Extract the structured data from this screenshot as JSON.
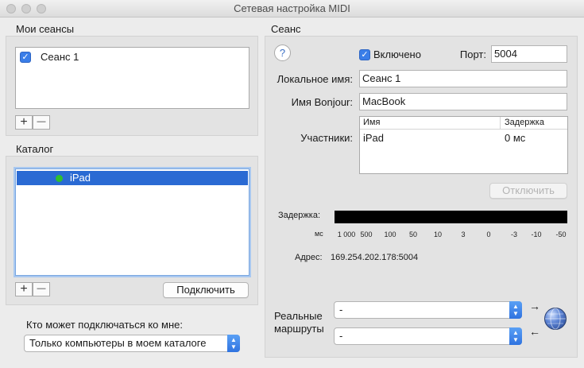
{
  "window": {
    "title": "Сетевая настройка MIDI"
  },
  "my_sessions": {
    "title": "Мои сеансы",
    "items": [
      {
        "label": "Сеанс 1",
        "checked": true
      }
    ],
    "add_label": "+",
    "remove_label": "—"
  },
  "directory": {
    "title": "Каталог",
    "items": [
      {
        "label": "iPad",
        "status_color": "#2ec02e",
        "selected": true
      }
    ],
    "add_label": "+",
    "remove_label": "—",
    "connect_label": "Подключить"
  },
  "who_can_connect": {
    "label": "Кто может подключаться ко мне:",
    "value": "Только компьютеры в моем каталоге"
  },
  "session": {
    "title": "Сеанс",
    "help_label": "?",
    "enabled_label": "Включено",
    "enabled": true,
    "port_label": "Порт:",
    "port_value": "5004",
    "local_name_label": "Локальное имя:",
    "local_name_value": "Сеанс 1",
    "bonjour_label": "Имя Bonjour:",
    "bonjour_value": "MacBook",
    "participants_label": "Участники:",
    "participants_columns": [
      "Имя",
      "Задержка"
    ],
    "participants_rows": [
      {
        "name": "iPad",
        "latency": "0 мс"
      }
    ],
    "disconnect_label": "Отключить",
    "latency_label": "Задержка:",
    "latency_unit": "мс",
    "latency_ticks": [
      "1 000",
      "500",
      "100",
      "50",
      "10",
      "3",
      "0",
      "-3",
      "-10",
      "-50"
    ],
    "address_label": "Адрес:",
    "address_value": "169.254.202.178:5004"
  },
  "live_routings": {
    "label_line1": "Реальные",
    "label_line2": "маршруты",
    "input_value": "-",
    "output_value": "-"
  },
  "colors": {
    "accent": "#2a6ad3",
    "status_online": "#2ec02e"
  }
}
